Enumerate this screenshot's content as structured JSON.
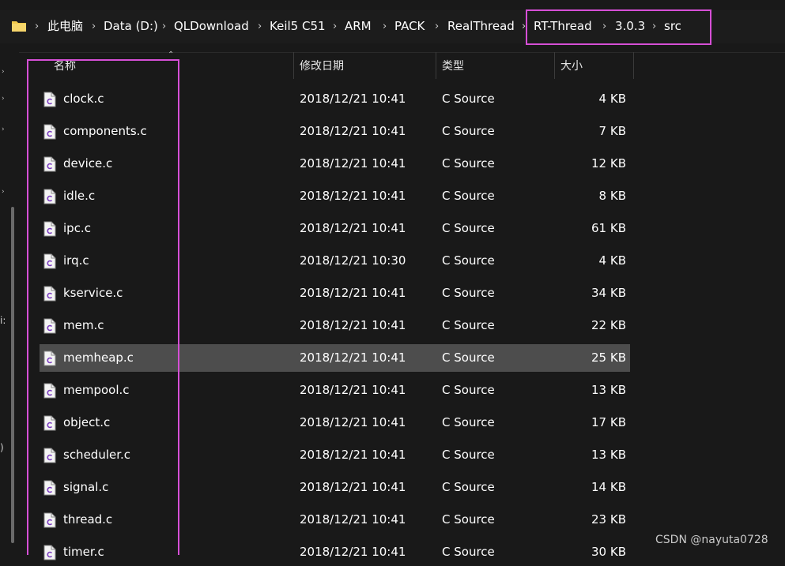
{
  "breadcrumb": [
    "此电脑",
    "Data (D:)",
    "QLDownload",
    "Keil5 C51",
    "ARM",
    "PACK",
    "RealThread",
    "RT-Thread",
    "3.0.3",
    "src"
  ],
  "breadcrumb_separator": "›",
  "columns": {
    "name": "名称",
    "date": "修改日期",
    "type": "类型",
    "size": "大小"
  },
  "files": [
    {
      "name": "clock.c",
      "date": "2018/12/21 10:41",
      "type": "C Source",
      "size": "4 KB"
    },
    {
      "name": "components.c",
      "date": "2018/12/21 10:41",
      "type": "C Source",
      "size": "7 KB"
    },
    {
      "name": "device.c",
      "date": "2018/12/21 10:41",
      "type": "C Source",
      "size": "12 KB"
    },
    {
      "name": "idle.c",
      "date": "2018/12/21 10:41",
      "type": "C Source",
      "size": "8 KB"
    },
    {
      "name": "ipc.c",
      "date": "2018/12/21 10:41",
      "type": "C Source",
      "size": "61 KB"
    },
    {
      "name": "irq.c",
      "date": "2018/12/21 10:30",
      "type": "C Source",
      "size": "4 KB"
    },
    {
      "name": "kservice.c",
      "date": "2018/12/21 10:41",
      "type": "C Source",
      "size": "34 KB"
    },
    {
      "name": "mem.c",
      "date": "2018/12/21 10:41",
      "type": "C Source",
      "size": "22 KB"
    },
    {
      "name": "memheap.c",
      "date": "2018/12/21 10:41",
      "type": "C Source",
      "size": "25 KB"
    },
    {
      "name": "mempool.c",
      "date": "2018/12/21 10:41",
      "type": "C Source",
      "size": "13 KB"
    },
    {
      "name": "object.c",
      "date": "2018/12/21 10:41",
      "type": "C Source",
      "size": "17 KB"
    },
    {
      "name": "scheduler.c",
      "date": "2018/12/21 10:41",
      "type": "C Source",
      "size": "13 KB"
    },
    {
      "name": "signal.c",
      "date": "2018/12/21 10:41",
      "type": "C Source",
      "size": "14 KB"
    },
    {
      "name": "thread.c",
      "date": "2018/12/21 10:41",
      "type": "C Source",
      "size": "23 KB"
    },
    {
      "name": "timer.c",
      "date": "2018/12/21 10:41",
      "type": "C Source",
      "size": "30 KB"
    }
  ],
  "selected_file": "memheap.c",
  "nav_edge_labels": [
    "i:",
    ")"
  ],
  "watermark": "CSDN @nayuta0728",
  "colors": {
    "background": "#191919",
    "selection": "#4d4d4d",
    "highlight_box": "#d64fd6",
    "folder": "#f2c94c"
  }
}
